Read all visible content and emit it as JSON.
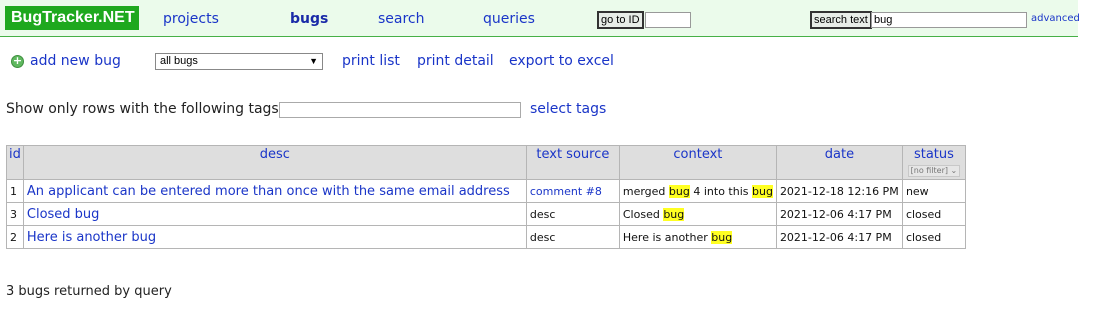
{
  "app": {
    "logo": "BugTracker.NET"
  },
  "nav": {
    "projects": "projects",
    "bugs": "bugs",
    "search": "search",
    "queries": "queries",
    "goto_button": "go to ID",
    "goto_value": "",
    "search_button": "search text",
    "search_value": "bug",
    "advanced": "advanced"
  },
  "toolbar": {
    "add_new_bug": "add new bug",
    "query_select": "all bugs",
    "print_list": "print list",
    "print_detail": "print detail",
    "export_excel": "export to excel"
  },
  "tags": {
    "label": "Show only rows with the following tags:",
    "value": "",
    "select_tags": "select tags"
  },
  "table": {
    "headers": {
      "id": "id",
      "desc": "desc",
      "text_source": "text source",
      "context": "context",
      "date": "date",
      "status": "status",
      "status_filter": "[no filter]"
    },
    "rows": [
      {
        "id": "1",
        "desc": "An applicant can be entered more than once with the same email address",
        "text_source": "comment #8",
        "context": {
          "a": "merged ",
          "b": "bug",
          "c": " 4 into this ",
          "d": "bug"
        },
        "date": "2021-12-18 12:16 PM",
        "status": "new"
      },
      {
        "id": "3",
        "desc": "Closed bug",
        "text_source": "desc",
        "context": {
          "a": "Closed ",
          "b": "bug"
        },
        "date": "2021-12-06 4:17 PM",
        "status": "closed"
      },
      {
        "id": "2",
        "desc": "Here is another bug",
        "text_source": "desc",
        "context": {
          "a": "Here is another ",
          "b": "bug"
        },
        "date": "2021-12-06 4:17 PM",
        "status": "closed"
      }
    ]
  },
  "footer": {
    "summary": "3 bugs returned by query"
  },
  "colors": {
    "nav_bg": "#ebfbeb",
    "logo_bg": "#1ea81e",
    "link": "#1a35c8",
    "highlight": "#ffff22",
    "header_bg": "#dedede"
  }
}
